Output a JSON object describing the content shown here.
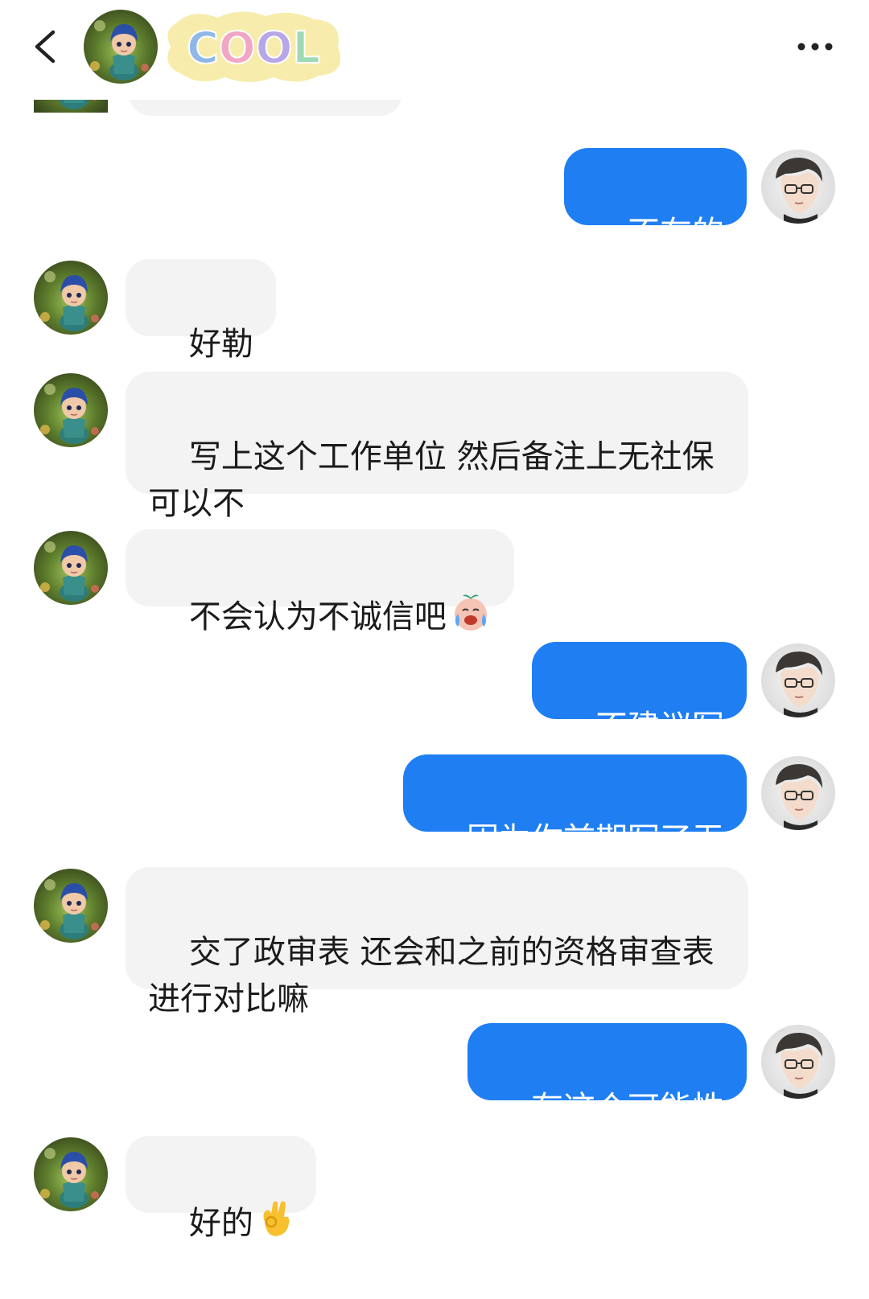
{
  "header": {
    "back_icon": "chevron-left-icon",
    "avatar_icon": "doll-avatar",
    "logo_text": "COOL",
    "more_icon": "more-horizontal-icon"
  },
  "colors": {
    "outgoing_bubble": "#1f7ff2",
    "incoming_bubble": "#f3f3f3",
    "text_dark": "#1b1b1b",
    "text_light": "#ffffff"
  },
  "messages": [
    {
      "side": "out",
      "text": "不在的"
    },
    {
      "side": "in",
      "text": "好勒"
    },
    {
      "side": "in",
      "text": "写上这个工作单位 然后备注上无社保可以不"
    },
    {
      "side": "in",
      "text": "不会认为不诚信吧",
      "emoji": "crying-laughing-emoji"
    },
    {
      "side": "out",
      "text": "不建议写"
    },
    {
      "side": "out",
      "text": "因为你前期写了无"
    },
    {
      "side": "in",
      "text": "交了政审表 还会和之前的资格审查表进行对比嘛"
    },
    {
      "side": "out",
      "text": "有这个可能性"
    },
    {
      "side": "in",
      "text": "好的",
      "emoji": "ok-hand-emoji"
    }
  ]
}
